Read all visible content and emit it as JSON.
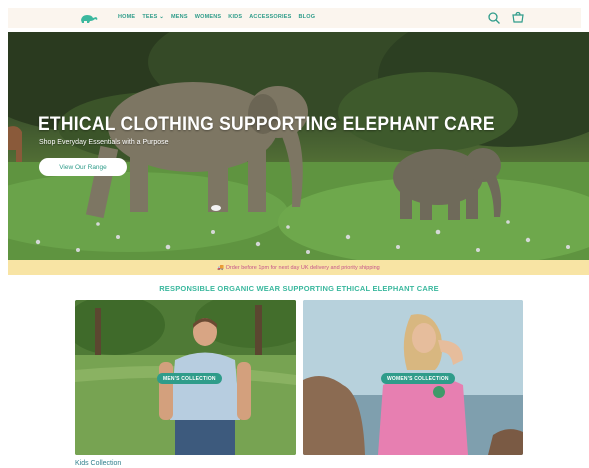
{
  "header": {
    "logo": "elephant-logo",
    "nav": [
      {
        "label": "Home"
      },
      {
        "label": "Tees ⌄"
      },
      {
        "label": "Mens"
      },
      {
        "label": "Womens"
      },
      {
        "label": "Kids"
      },
      {
        "label": "Accessories"
      },
      {
        "label": "Blog"
      }
    ],
    "icons": [
      "search-icon",
      "cart-icon"
    ]
  },
  "hero": {
    "title": "Ethical Clothing Supporting Elephant Care",
    "subtitle": "Shop Everyday Essentials with a Purpose",
    "button_label": "View Our Range"
  },
  "announcement": {
    "text": "🚚 Order before 1pm for next day UK delivery and priority shipping"
  },
  "collections": {
    "title": "Responsible Organic Wear Supporting Ethical Elephant Care",
    "cards": [
      {
        "badge": "Men's Collection"
      },
      {
        "badge": "Women's Collection"
      }
    ],
    "next_title": "Kids Collection"
  },
  "colors": {
    "accent": "#2f9c8a",
    "announcement_bg": "#f8e4a4",
    "announcement_text": "#c5548a",
    "header_bg": "#fbf5ee"
  }
}
